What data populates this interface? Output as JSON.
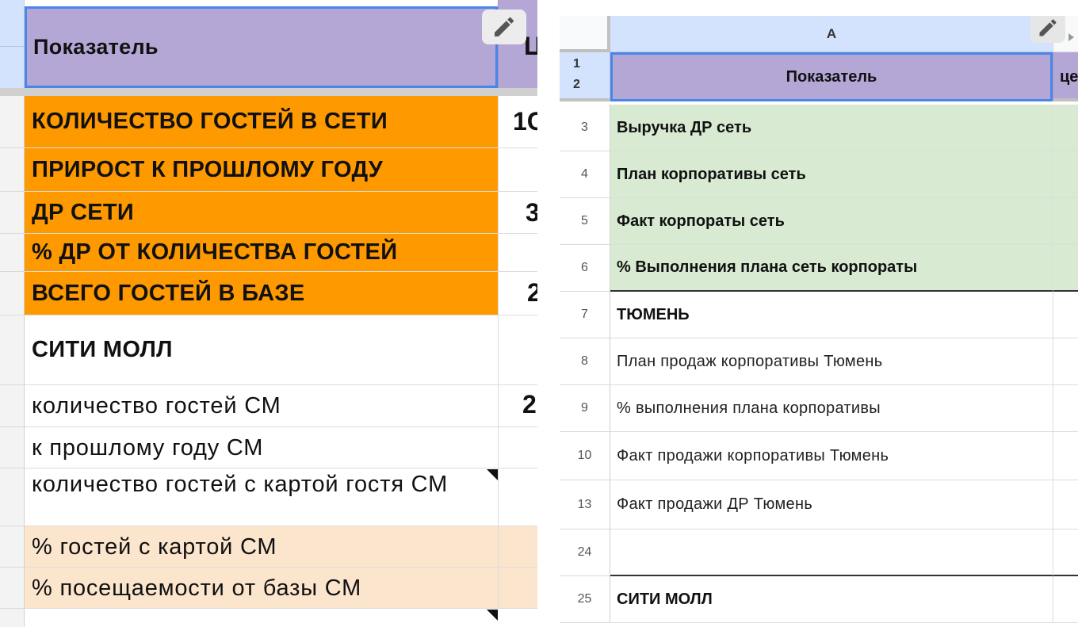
{
  "left_sheet": {
    "header_cell": "Показатель",
    "next_col_header_partial": "Ц",
    "rows": [
      {
        "label": "КОЛИЧЕСТВО ГОСТЕЙ В СЕТИ",
        "next_partial": "1С"
      },
      {
        "label": "ПРИРОСТ К ПРОШЛОМУ ГОДУ",
        "next_partial": ""
      },
      {
        "label": "ДР СЕТИ",
        "next_partial": "3"
      },
      {
        "label": "% ДР ОТ КОЛИЧЕСТВА ГОСТЕЙ",
        "next_partial": ""
      },
      {
        "label": "ВСЕГО ГОСТЕЙ В БАЗЕ",
        "next_partial": "2"
      },
      {
        "label": "СИТИ МОЛЛ",
        "next_partial": ""
      },
      {
        "label": "количество гостей СМ",
        "next_partial": "2"
      },
      {
        "label": "к прошлому году СМ",
        "next_partial": ""
      },
      {
        "label": "количество гостей с картой гостя СМ",
        "next_partial": ""
      },
      {
        "label": "% гостей с картой СМ",
        "next_partial": ""
      },
      {
        "label": "% посещаемости от базы СМ",
        "next_partial": ""
      }
    ],
    "edit_icon": "pencil-icon"
  },
  "right_sheet": {
    "column_letter": "A",
    "header_row_numbers": [
      "1",
      "2"
    ],
    "header_cell": "Показатель",
    "next_col_header_partial": "це",
    "rows": [
      {
        "num": "3",
        "label": "Выручка ДР сеть"
      },
      {
        "num": "4",
        "label": "План корпоративы сеть"
      },
      {
        "num": "5",
        "label": "Факт корпораты сеть"
      },
      {
        "num": "6",
        "label": "% Выполнения плана сеть корпораты"
      },
      {
        "num": "7",
        "label": "ТЮМЕНЬ"
      },
      {
        "num": "8",
        "label": "План продаж корпоративы Тюмень"
      },
      {
        "num": "9",
        "label": "% выполнения плана корпоративы"
      },
      {
        "num": "10",
        "label": "Факт продажи корпоративы Тюмень"
      },
      {
        "num": "13",
        "label": "Факт продажи ДР Тюмень"
      },
      {
        "num": "24",
        "label": ""
      },
      {
        "num": "25",
        "label": "СИТИ МОЛЛ"
      }
    ],
    "edit_icon": "pencil-icon",
    "scroll_icon": "chevron-right-icon"
  },
  "colors": {
    "orange_fill": "#ff9900",
    "peach_fill": "#fce5cd",
    "green_fill": "#d9ead3",
    "header_fill": "#b4a7d6",
    "selection_border": "#4a86e8",
    "column_header_fill": "#d3e3fd"
  }
}
